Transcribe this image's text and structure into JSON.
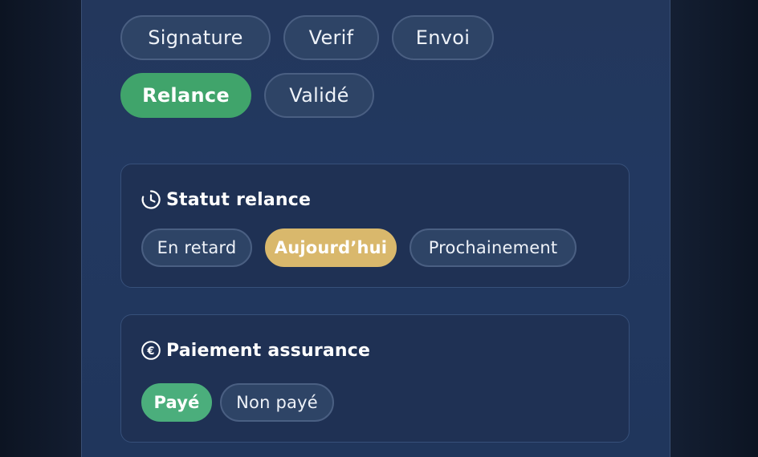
{
  "steps": {
    "items": [
      {
        "label": "Signature",
        "active": false
      },
      {
        "label": "Verif",
        "active": false
      },
      {
        "label": "Envoi",
        "active": false
      },
      {
        "label": "Relance",
        "active": true
      },
      {
        "label": "Validé",
        "active": false
      }
    ]
  },
  "relance": {
    "title": "Statut relance",
    "icon": "clock-icon",
    "options": [
      {
        "label": "En retard",
        "active": false
      },
      {
        "label": "Aujourd’hui",
        "active": true
      },
      {
        "label": "Prochainement",
        "active": false
      }
    ]
  },
  "assurance": {
    "title": "Paiement assurance",
    "icon": "euro-icon",
    "options": [
      {
        "label": "Payé",
        "active": true
      },
      {
        "label": "Non payé",
        "active": false
      }
    ]
  },
  "colors": {
    "green": "#40a46b",
    "gold": "#d9b86c",
    "mint": "#4bae7c",
    "panel": "#223860"
  }
}
